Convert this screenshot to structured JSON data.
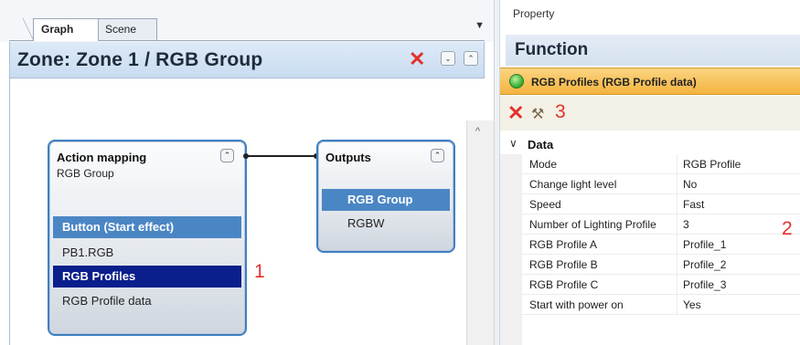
{
  "graph_panel": {
    "tabs": [
      {
        "label": "Graph",
        "active": true
      },
      {
        "label": "Scene",
        "active": false
      }
    ],
    "dropdown_icon": "chevron-down",
    "zone_title": "Zone: Zone 1 / RGB Group",
    "nodes": {
      "action_mapping": {
        "title": "Action mapping",
        "subtitle": "RGB Group",
        "rows": [
          {
            "label": "Button (Start effect)",
            "state": "highlighted"
          },
          {
            "label": "PB1.RGB",
            "state": "normal"
          },
          {
            "label": "RGB Profiles",
            "state": "selected"
          },
          {
            "label": "RGB Profile data",
            "state": "normal"
          }
        ]
      },
      "outputs": {
        "title": "Outputs",
        "rows": [
          {
            "label": "RGB Group",
            "state": "highlighted"
          },
          {
            "label": "RGBW",
            "state": "normal"
          }
        ]
      }
    },
    "annotation": "1"
  },
  "property_panel": {
    "label": "Property",
    "title": "Function",
    "profile_header": "RGB Profiles (RGB Profile data)",
    "toolbar_annotation": "3",
    "group": "Data",
    "properties": [
      {
        "name": "Mode",
        "value": "RGB Profile"
      },
      {
        "name": "Change light level",
        "value": "No"
      },
      {
        "name": "Speed",
        "value": "Fast"
      },
      {
        "name": "Number of Lighting Profile",
        "value": "3"
      },
      {
        "name": "RGB Profile A",
        "value": "Profile_1"
      },
      {
        "name": "RGB Profile B",
        "value": "Profile_2"
      },
      {
        "name": "RGB Profile C",
        "value": "Profile_3"
      },
      {
        "name": "Start with power on",
        "value": "Yes"
      }
    ],
    "annotation": "2"
  },
  "colors": {
    "accent_blue": "#4b86c4",
    "selected_dark_blue": "#0a1e8c",
    "annotation_red": "#e4312b",
    "profile_orange": "#f3b440"
  }
}
